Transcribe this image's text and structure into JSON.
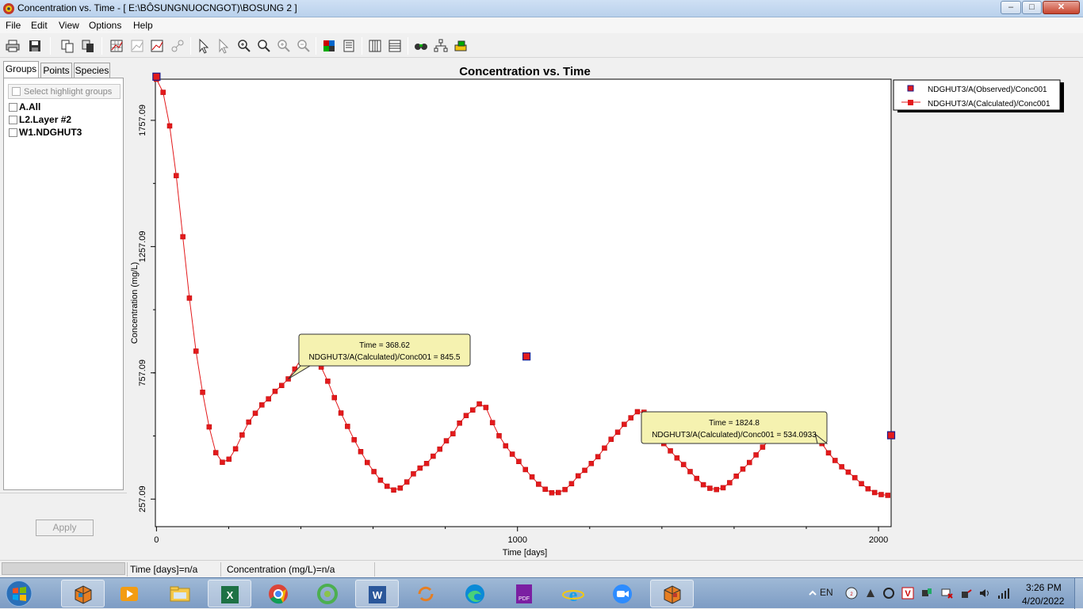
{
  "window": {
    "title": "Concentration vs. Time - [ E:\\BÔSUNGNUOCNGOT)\\BOSUNG 2 ]",
    "controls": {
      "minimize": "–",
      "maximize": "□",
      "close": "✕"
    }
  },
  "menu": [
    "File",
    "Edit",
    "View",
    "Options",
    "Help"
  ],
  "toolbar": {
    "icons": [
      "print-icon",
      "save-icon",
      "copy-icon",
      "copy-data-icon",
      "grid-icon",
      "chart-type-icon",
      "log-scale-icon",
      "legend-toggle-icon",
      "select-pointer-icon",
      "identify-pointer-icon",
      "zoom-in-icon",
      "zoom-window-icon",
      "zoom-plus-icon",
      "zoom-minus-icon",
      "colors-icon",
      "properties-icon",
      "columns-icon",
      "rows-icon",
      "find-icon",
      "tree-icon",
      "palette-icon"
    ]
  },
  "left_panel": {
    "tabs": [
      "Groups",
      "Points",
      "Species"
    ],
    "active_tab": "Groups",
    "highlight_label": "Select highlight groups",
    "groups": [
      "A.All",
      "L2.Layer #2",
      "W1.NDGHUT3"
    ],
    "apply_label": "Apply"
  },
  "chart_data": {
    "type": "line",
    "title": "Concentration vs. Time",
    "xlabel": "Time  [days]",
    "ylabel": "Concentration  (mg/L)",
    "xlim": [
      -3,
      2035
    ],
    "ylim": [
      148,
      1920
    ],
    "x_ticks": [
      0,
      1000,
      2000
    ],
    "x_tick_labels": [
      "0",
      "1000",
      "2000"
    ],
    "y_ticks": [
      257.09,
      757.09,
      1257.09,
      1757.09
    ],
    "y_tick_labels": [
      "257.09",
      "757.09",
      "1257.09",
      "1757.09"
    ],
    "legend_position": "top-right outside",
    "grid": false,
    "series": [
      {
        "name": "NDGHUT3/A(Observed)/Conc001",
        "style": "markers",
        "color": "#e31a1c",
        "x": [
          0,
          1025,
          2035
        ],
        "y": [
          1930,
          822,
          510
        ]
      },
      {
        "name": "NDGHUT3/A(Calculated)/Conc001",
        "style": "line+markers",
        "color": "#e31a1c",
        "x": [
          0,
          18.25,
          36.5,
          54.75,
          73,
          91.25,
          109.5,
          127.75,
          146,
          164.25,
          182.5,
          200.75,
          219,
          237.25,
          255.5,
          273.75,
          292,
          310.25,
          328.5,
          346.75,
          365,
          383.25,
          401.5,
          419.75,
          438,
          456.25,
          474.5,
          492.75,
          511,
          529.25,
          547.5,
          565.75,
          584,
          602.25,
          620.5,
          638.75,
          657,
          675.25,
          693.5,
          711.75,
          730,
          748.25,
          766.5,
          784.75,
          803,
          821.25,
          839.5,
          857.75,
          876,
          894.25,
          912.5,
          930.75,
          949,
          967.25,
          985.5,
          1003.75,
          1022,
          1040.25,
          1058.5,
          1076.75,
          1095,
          1113.25,
          1131.5,
          1149.75,
          1168,
          1186.25,
          1204.5,
          1222.75,
          1241,
          1259.25,
          1277.5,
          1295.75,
          1314,
          1332.25,
          1350.5,
          1368.75,
          1387,
          1405.25,
          1423.5,
          1441.75,
          1460,
          1478.25,
          1496.5,
          1514.75,
          1533,
          1551.25,
          1569.5,
          1587.75,
          1606,
          1624.25,
          1642.5,
          1660.75,
          1679,
          1697.25,
          1715.5,
          1733.75,
          1752,
          1770.25,
          1788.5,
          1806.75,
          1825,
          1843.25,
          1861.5,
          1879.75,
          1898,
          1916.25,
          1934.5,
          1952.75,
          1971,
          1989.25,
          2007.5,
          2025.75
        ],
        "y": [
          1920,
          1868,
          1735,
          1538,
          1296,
          1053,
          843,
          680,
          543,
          441,
          403,
          415,
          456,
          511,
          562,
          597,
          630,
          654,
          684,
          707,
          733,
          772,
          814,
          841,
          830,
          780,
          724,
          659,
          598,
          545,
          492,
          445,
          402,
          366,
          332,
          308,
          293,
          301,
          325,
          357,
          380,
          398,
          427,
          455,
          488,
          516,
          558,
          588,
          610,
          634,
          620,
          560,
          508,
          468,
          435,
          406,
          374,
          345,
          316,
          296,
          282,
          283,
          295,
          318,
          349,
          371,
          398,
          425,
          459,
          494,
          522,
          553,
          579,
          603,
          601,
          562,
          521,
          477,
          448,
          420,
          394,
          366,
          339,
          314,
          300,
          295,
          302,
          322,
          348,
          376,
          402,
          432,
          463,
          491,
          516,
          543,
          568,
          589,
          590,
          560,
          514,
          477,
          440,
          410,
          385,
          364,
          342,
          318,
          298,
          283,
          275,
          272
        ]
      }
    ],
    "tooltips": [
      {
        "line1": "Time = 368.62",
        "line2": "NDGHUT3/A(Calculated)/Conc001 = 845.5"
      },
      {
        "line1": "Time = 1824.8",
        "line2": "NDGHUT3/A(Calculated)/Conc001 = 534.0933"
      }
    ]
  },
  "status": {
    "time_readout": "Time  [days]=n/a",
    "conc_readout": "Concentration (mg/L)=n/a"
  },
  "taskbar": {
    "apps": [
      "visual-modflow-icon",
      "media-player-icon",
      "file-explorer-icon",
      "excel-icon",
      "chrome-icon",
      "coccoc-icon",
      "word-icon",
      "sync-icon",
      "edge-icon",
      "pdf-icon",
      "ie-icon",
      "zoom-icon",
      "visual-modflow-2-icon"
    ],
    "language": "EN",
    "clock_time": "3:26 PM",
    "clock_date": "4/20/2022"
  }
}
